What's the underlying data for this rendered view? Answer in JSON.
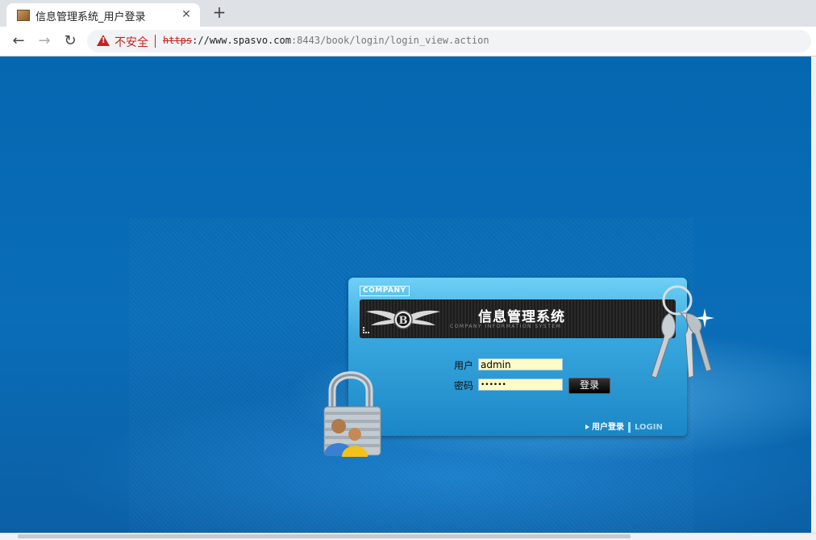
{
  "tab": {
    "title": "信息管理系统_用户登录",
    "close": "✕",
    "new_tab": "+"
  },
  "toolbar": {
    "back": "←",
    "forward": "→",
    "reload": "↻",
    "security_label": "不安全",
    "url_scheme": "https",
    "url_host": "://www.spasvo.com",
    "url_path": ":8443/book/login/login_view.action"
  },
  "panel": {
    "company_label": "COMPANY",
    "title": "信息管理系统",
    "subtitle": "COMPANY INFORMATION SYSTEM",
    "user_label": "用户",
    "user_value": "admin",
    "password_label": "密码",
    "password_value": "••••••",
    "login_button": "登录",
    "footer_user_login": "用户登录",
    "footer_login": "LOGIN"
  },
  "icons": [
    "warning-icon",
    "lock-users-icon",
    "keys-icon",
    "winged-logo-icon"
  ],
  "colors": {
    "page_bg": "#0a6bb3",
    "panel_top": "#6fd0f6",
    "field_bg": "#fffbc7",
    "warning": "#c5221f"
  }
}
